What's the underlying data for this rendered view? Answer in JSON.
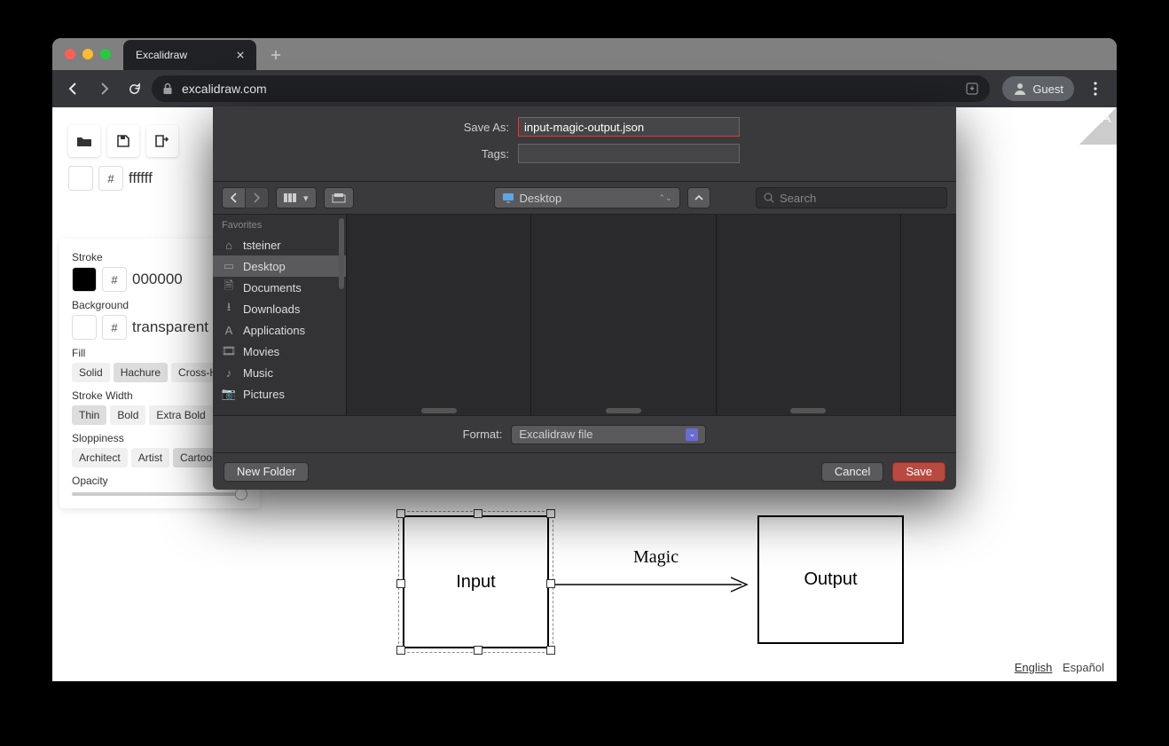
{
  "browser": {
    "tab_title": "Excalidraw",
    "url": "excalidraw.com",
    "guest_label": "Guest"
  },
  "toolbar": {
    "canvas_bg_hex": "ffffff"
  },
  "panel": {
    "stroke_label": "Stroke",
    "stroke_hex": "000000",
    "background_label": "Background",
    "background_value": "transparent",
    "fill_label": "Fill",
    "fill_options": [
      "Solid",
      "Hachure",
      "Cross-Hatch"
    ],
    "stroke_width_label": "Stroke Width",
    "stroke_width_options": [
      "Thin",
      "Bold",
      "Extra Bold"
    ],
    "sloppiness_label": "Sloppiness",
    "sloppiness_options": [
      "Architect",
      "Artist",
      "Cartoonist"
    ],
    "opacity_label": "Opacity"
  },
  "drawing": {
    "box1": "Input",
    "box2": "Output",
    "arrow_label": "Magic"
  },
  "lang": {
    "en": "English",
    "es": "Español"
  },
  "dialog": {
    "save_as_label": "Save As:",
    "save_as_value": "input-magic-output.json",
    "tags_label": "Tags:",
    "tags_value": "",
    "location": "Desktop",
    "search_placeholder": "Search",
    "favorites_header": "Favorites",
    "favorites": [
      "tsteiner",
      "Desktop",
      "Documents",
      "Downloads",
      "Applications",
      "Movies",
      "Music",
      "Pictures"
    ],
    "format_label": "Format:",
    "format_value": "Excalidraw file",
    "new_folder": "New Folder",
    "cancel": "Cancel",
    "save": "Save"
  }
}
